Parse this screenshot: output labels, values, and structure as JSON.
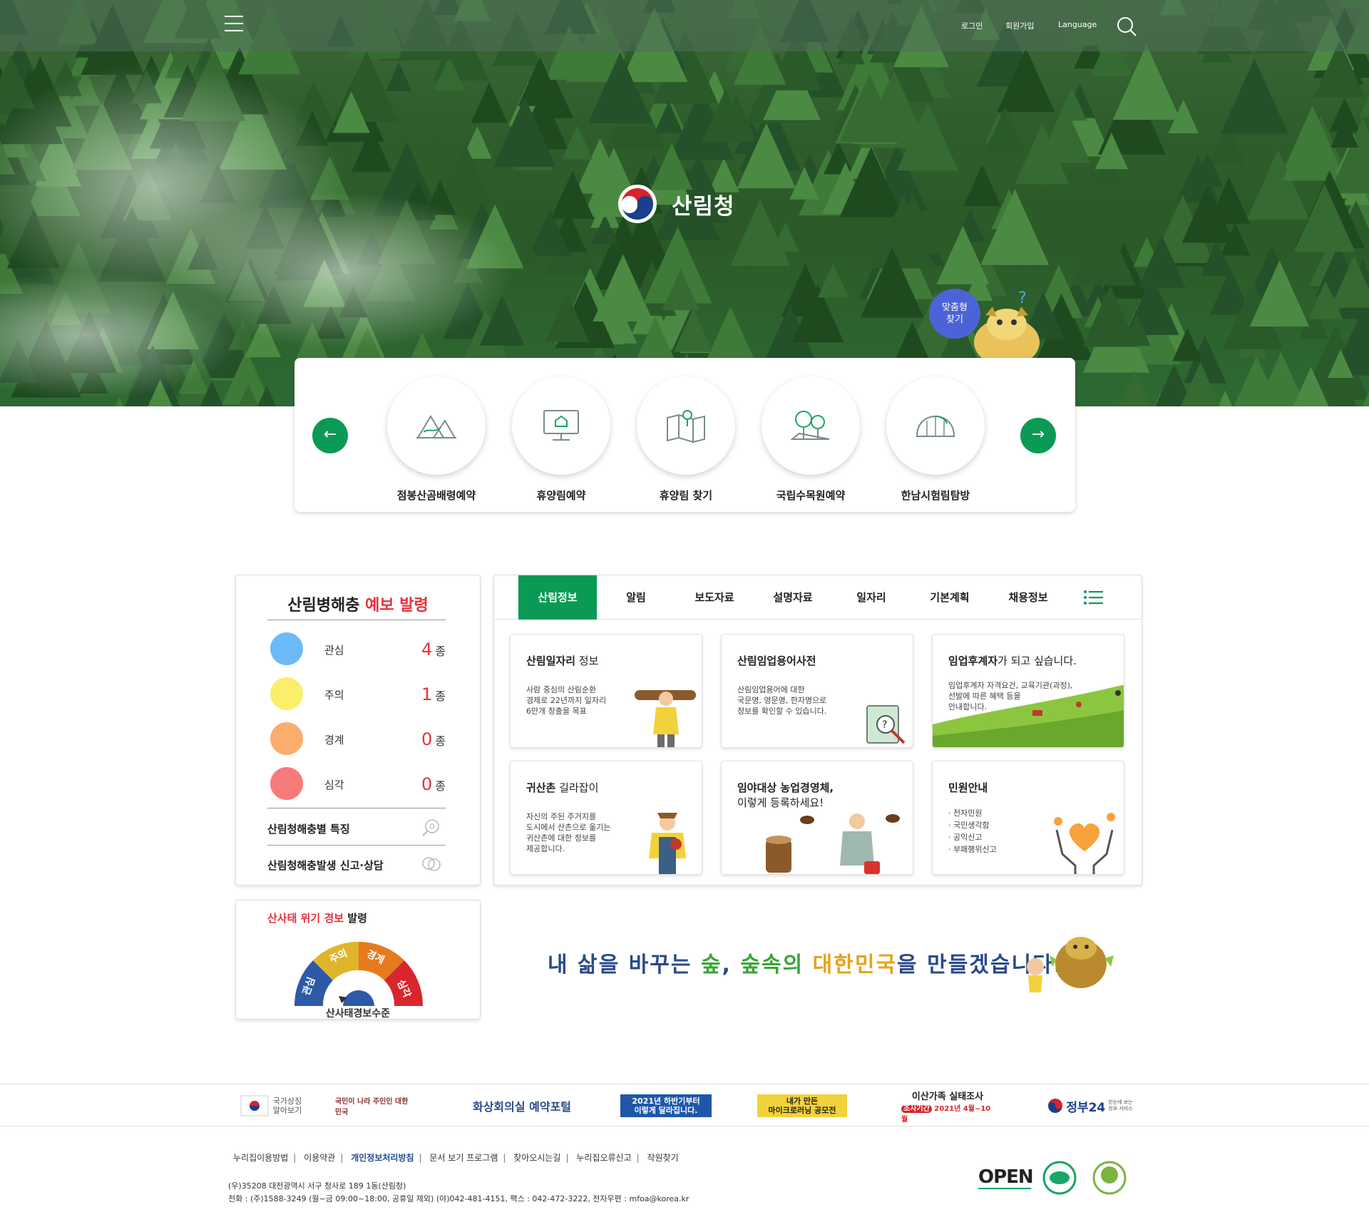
{
  "header": {
    "menu_icon": "hamburger-menu-icon",
    "login": "로그인",
    "signup": "회원가입",
    "language": "Language",
    "search_icon": "search-icon"
  },
  "hero": {
    "logo_text": "산림청",
    "custom_search": "맞춤형\n찾기"
  },
  "quick_links": {
    "items": [
      {
        "label": "점봉산곰배령예약",
        "icon": "mountain-icon"
      },
      {
        "label": "휴양림예약",
        "icon": "monitor-house-icon"
      },
      {
        "label": "휴양림 찾기",
        "icon": "map-pin-icon"
      },
      {
        "label": "국립수목원예약",
        "icon": "trees-icon"
      },
      {
        "label": "한남시험림탐방",
        "icon": "greenhouse-icon"
      }
    ],
    "prev_icon": "arrow-left-icon",
    "next_icon": "arrow-right-icon"
  },
  "pest": {
    "title_prefix": "산림병해충",
    "title_red": "예보 발령",
    "levels": [
      {
        "label": "관심",
        "count": "4",
        "unit": "종",
        "color": "#6bbaf7"
      },
      {
        "label": "주의",
        "count": "1",
        "unit": "종",
        "color": "#fbee6a"
      },
      {
        "label": "경계",
        "count": "0",
        "unit": "종",
        "color": "#fbad6e"
      },
      {
        "label": "심각",
        "count": "0",
        "unit": "종",
        "color": "#f77a7a"
      }
    ],
    "link1": "산림청해충별 특징",
    "link2": "산림청해충발생 신고·상담"
  },
  "tabs": {
    "items": [
      "산림정보",
      "알림",
      "보도자료",
      "설명자료",
      "일자리",
      "기본계획",
      "채용정보"
    ],
    "active": "산림정보"
  },
  "cards": [
    {
      "title_bold": "산림일자리",
      "title_rest": " 정보",
      "desc": "사람 중심의 산림순환\n경제로 22년까지 일자리\n6만개 창출을 목표"
    },
    {
      "title_bold": "산림임업용어사전",
      "title_rest": "",
      "desc": "산림임업용어에 대한\n국문명, 영문명, 한자명으로\n정보를 확인할 수 있습니다."
    },
    {
      "title_bold": "임업후계자",
      "title_rest": "가 되고 싶습니다.",
      "desc": "임업후계자 자격요건, 교육기관(과정),\n선발에 따른 혜택 등을\n안내합니다."
    },
    {
      "title_bold": "귀산촌",
      "title_rest": " 길라잡이",
      "desc": "자신의 주된 주거지를\n도시에서 산촌으로 옮기는\n귀산촌에 대한 정보를\n제공합니다."
    },
    {
      "title_bold": "임야대상 농업경영체,",
      "title_rest": "\n이렇게 등록하세요!",
      "desc": ""
    },
    {
      "title_bold": "민원안내",
      "title_rest": "",
      "desc": "· 전자민원\n· 국민생각함\n· 공익신고\n· 부패행위신고"
    }
  ],
  "landslide": {
    "title_red": "산사태 위기 경보",
    "title_rest": " 발령",
    "levels": [
      "관심",
      "주의",
      "경계",
      "심각"
    ],
    "caption": "산사태경보수준"
  },
  "slogan": {
    "part1": "내 삶을 바꾸는 ",
    "part2": "숲",
    "part3": ", ",
    "part4": "숲속",
    "part5": "의 ",
    "part6": "대한민국",
    "part7": "을 만들겠습니다."
  },
  "banners": [
    "국가상징\n알아보기",
    "국민이 나라 주인인 대한민국",
    "화상회의실 예약포털",
    "2021년 하반기부터\n이렇게 달라집니다.",
    "내가 만든\n마이크로러닝 공모전",
    "이산가족 실태조사",
    "정부24"
  ],
  "banner_sub": {
    "family_period_tag": "조사기간",
    "family_period": "2021년 4월~10월",
    "gov24_sub": "한눈에 보는\n정부 서비스"
  },
  "footer": {
    "links": [
      "누리집이용방법",
      "이용약관",
      "개인정보처리방침",
      "문서 보기 프로그램",
      "찾아오시는길",
      "누리집오류신고",
      "작원찾기"
    ],
    "address": "(우)35208 대전광역시 서구 청사로 189 1동(산림청)",
    "contact": "전화 : (주)1588-3249 (월~금 09:00~18:00, 공휴일 제외) (야)042-481-4151, 팩스 : 042-472-3222, 전자우편 : mfoa@korea.kr",
    "cert1": "OPEN"
  },
  "colors": {
    "accent": "#0b9a55",
    "alert": "#e8313c",
    "navy": "#2a4a8a"
  }
}
